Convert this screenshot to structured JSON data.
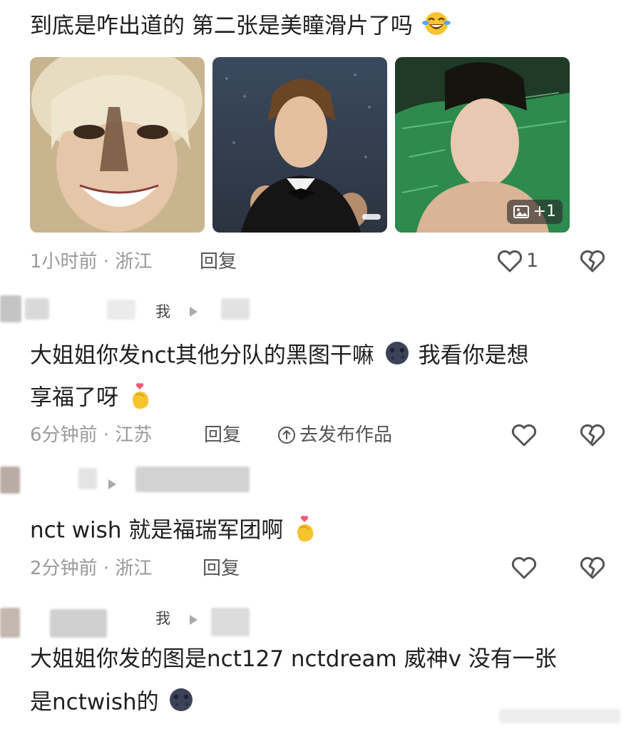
{
  "comment1": {
    "text": "到底是咋出道的 第二张是美瞳滑片了吗",
    "emoji_icon": "tears-of-joy-emoji",
    "photos": [
      {
        "name": "photo-blonde-selfie"
      },
      {
        "name": "photo-suit-concert"
      },
      {
        "name": "photo-pool-selfie",
        "more_label": "+1"
      }
    ],
    "time_location": "1小时前 · 浙江",
    "reply_label": "回复",
    "like_count": "1"
  },
  "reply1": {
    "me_tag": "我",
    "text_line1": "大姐姐你发nct其他分队的黑图干嘛",
    "text_line1_tail": "我看你是想",
    "text_line2": "享福了呀",
    "time_location": "6分钟前 · 江苏",
    "reply_label": "回复",
    "publish_label": "去发布作品"
  },
  "reply2": {
    "text": "nct wish 就是福瑞军团啊",
    "time_location": "2分钟前 · 浙江",
    "reply_label": "回复"
  },
  "reply3": {
    "me_tag": "我",
    "text_line1": "大姐姐你发的图是nct127 nctdream 威神v 没有一张",
    "text_line2": "是nctwish的"
  },
  "colors": {
    "text": "#1f1f1f",
    "meta": "#9a9a9a",
    "icon": "#555555",
    "avatar_blur": "#d4d4d4"
  }
}
